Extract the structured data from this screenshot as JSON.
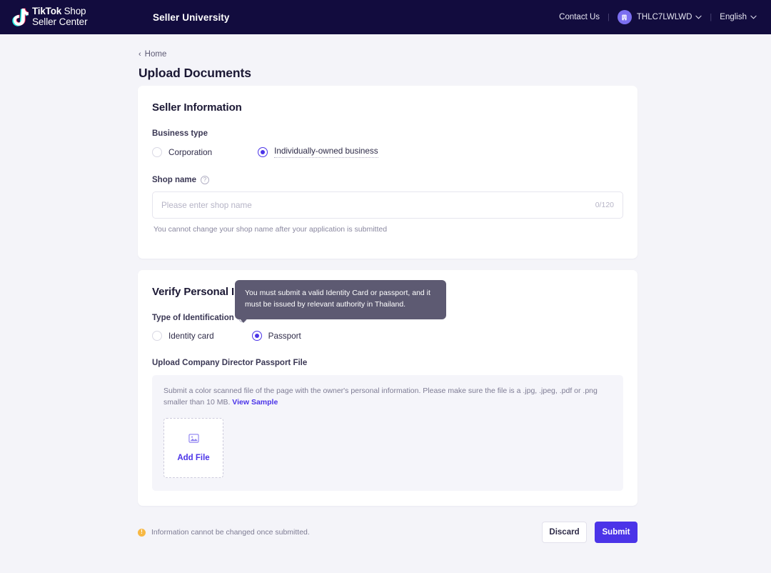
{
  "topnav": {
    "logo": {
      "line1_bold": "TikTok",
      "line1_thin": " Shop",
      "line2": "Seller Center",
      "icon": "tiktok-note-icon"
    },
    "center_link": "Seller University",
    "contact_us": "Contact Us",
    "separator": "|",
    "account_name": "THLC7LWLWD",
    "language": "English",
    "caret": "∨"
  },
  "breadcrumb": {
    "chevron": "‹",
    "label": "Home"
  },
  "page_title": "Upload Documents",
  "seller_information": {
    "title": "Seller Information",
    "business_type_label": "Business type",
    "options": [
      {
        "label": "Corporation",
        "selected": false
      },
      {
        "label": "Individually-owned business",
        "selected": true
      }
    ],
    "shop_name_label": "Shop name",
    "help_glyph": "?",
    "shop_name_value": "",
    "shop_name_placeholder": "Please enter shop name",
    "counter": "0/120",
    "hint": "You cannot change your shop name after your application is submitted"
  },
  "verify_personal": {
    "title": "Verify Personal Information",
    "tooltip": "You must submit a valid Identity Card or passport, and it must be issued by relevant authority in Thailand.",
    "type_label": "Type of Identification",
    "help_glyph": "?",
    "options": [
      {
        "label": "Identity card",
        "selected": false
      },
      {
        "label": "Passport",
        "selected": true
      }
    ],
    "upload_title": "Upload Company Director Passport File",
    "upload_desc_part1": "Submit a color scanned file of the page with the owner's personal information. Please make sure the file is a .jpg, .jpeg, .pdf or .png smaller than 10 MB. ",
    "upload_desc_link": "View Sample",
    "add_file_label": "Add File"
  },
  "footer": {
    "warning_glyph": "!",
    "warning_text": "Information cannot be changed once submitted.",
    "discard_label": "Discard",
    "submit_label": "Submit"
  },
  "colors": {
    "brand_purple": "#4b34e8",
    "nav_bg": "#120c3e",
    "page_bg": "#f4f4f9",
    "tooltip_bg": "#5d5a72",
    "warning": "#f7b844"
  }
}
